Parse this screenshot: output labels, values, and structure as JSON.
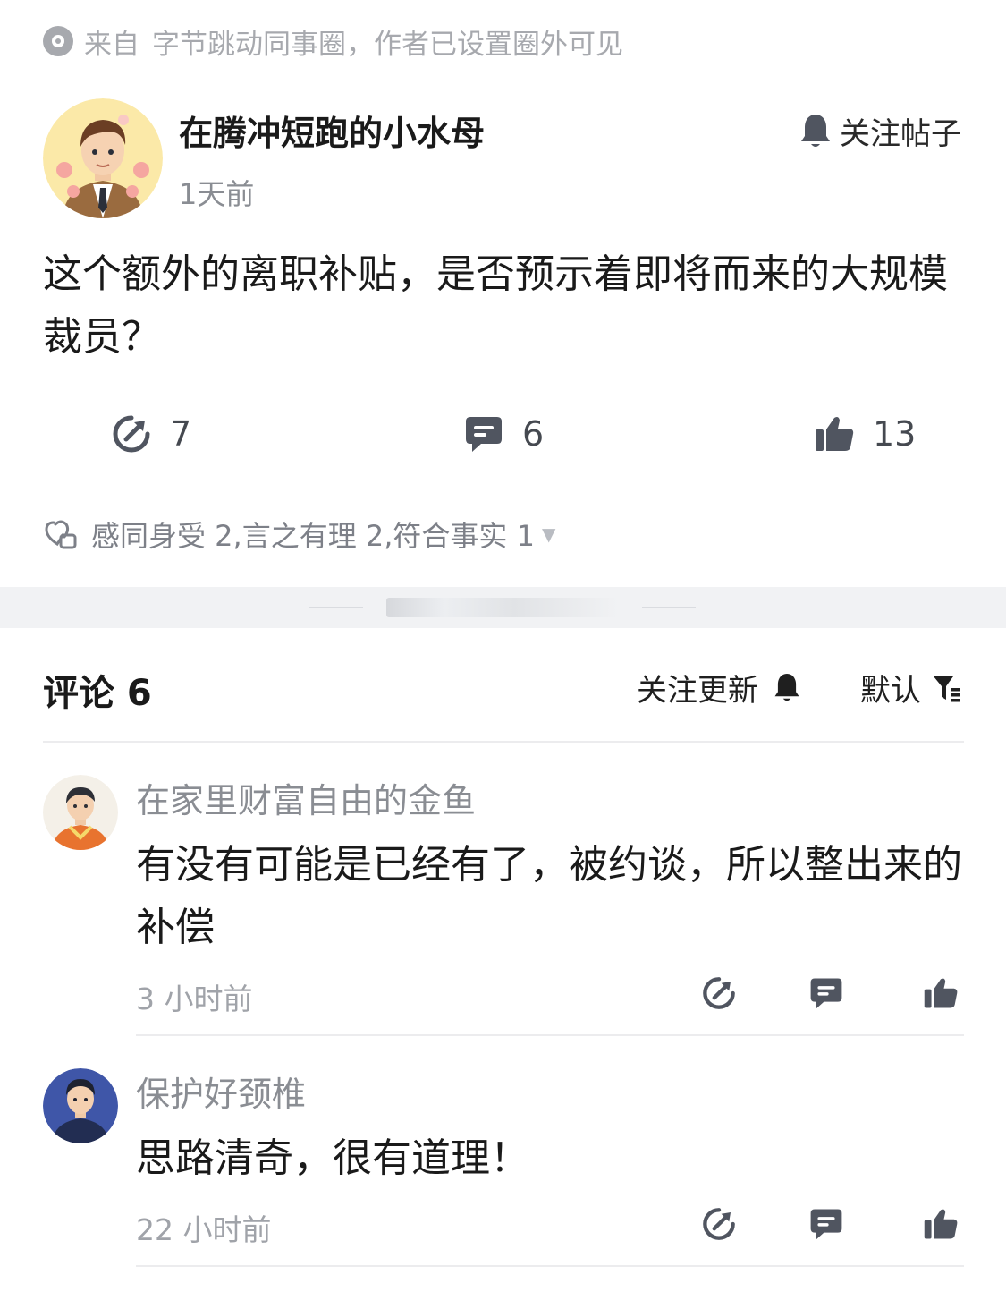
{
  "source": {
    "prefix": "来自",
    "text": "字节跳动同事圈，作者已设置圈外可见"
  },
  "post": {
    "author_name": "在腾冲短跑的小水母",
    "time": "1天前",
    "follow_label": "关注帖子",
    "content": "这个额外的离职补贴，是否预示着即将而来的大规模裁员？",
    "share_count": "7",
    "comment_count": "6",
    "like_count": "13",
    "reactions": "感同身受 2,言之有理 2,符合事实 1"
  },
  "comments_header": {
    "title": "评论 6",
    "follow_updates_label": "关注更新",
    "sort_label": "默认"
  },
  "comments": [
    {
      "user": "在家里财富自由的金鱼",
      "text": "有没有可能是已经有了，被约谈，所以整出来的补偿",
      "time": "3 小时前"
    },
    {
      "user": "保护好颈椎",
      "text": "思路清奇，很有道理！",
      "time": "22 小时前"
    }
  ],
  "colors": {
    "icon_gray": "#505560",
    "muted_text": "#a7a9ae",
    "band_bg": "#f1f2f4"
  },
  "icons": {
    "source": "circle-dot-icon",
    "follow": "bell-icon",
    "share": "share-arrow-icon",
    "comment": "speech-bubble-icon",
    "like": "thumbs-up-icon",
    "reactions": "reactions-heart-icon",
    "sort": "filter-icon"
  }
}
